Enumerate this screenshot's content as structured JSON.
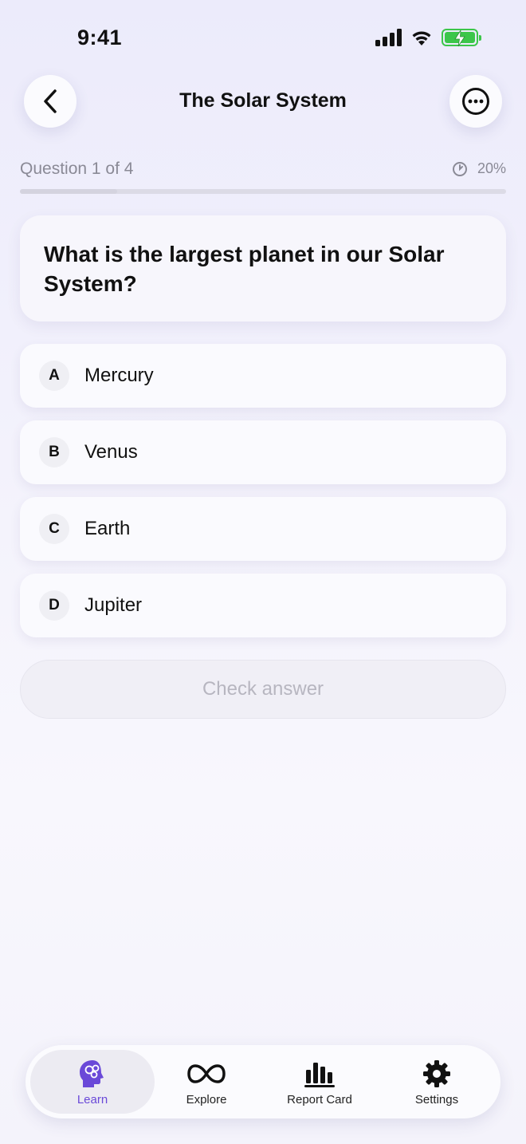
{
  "status": {
    "time": "9:41"
  },
  "header": {
    "title": "The Solar System"
  },
  "progress": {
    "label": "Question 1 of 4",
    "percent_label": "20%",
    "fraction": 0.2
  },
  "question": {
    "text": "What is the largest planet in our Solar System?"
  },
  "options": [
    {
      "letter": "A",
      "text": "Mercury"
    },
    {
      "letter": "B",
      "text": "Venus"
    },
    {
      "letter": "C",
      "text": "Earth"
    },
    {
      "letter": "D",
      "text": "Jupiter"
    }
  ],
  "check_button": {
    "label": "Check answer"
  },
  "tabs": [
    {
      "label": "Learn",
      "icon": "brain-head-icon",
      "active": true
    },
    {
      "label": "Explore",
      "icon": "infinity-icon"
    },
    {
      "label": "Report Card",
      "icon": "bar-chart-icon"
    },
    {
      "label": "Settings",
      "icon": "gear-icon"
    }
  ],
  "colors": {
    "accent": "#6a49d8",
    "battery": "#3cc64a"
  }
}
